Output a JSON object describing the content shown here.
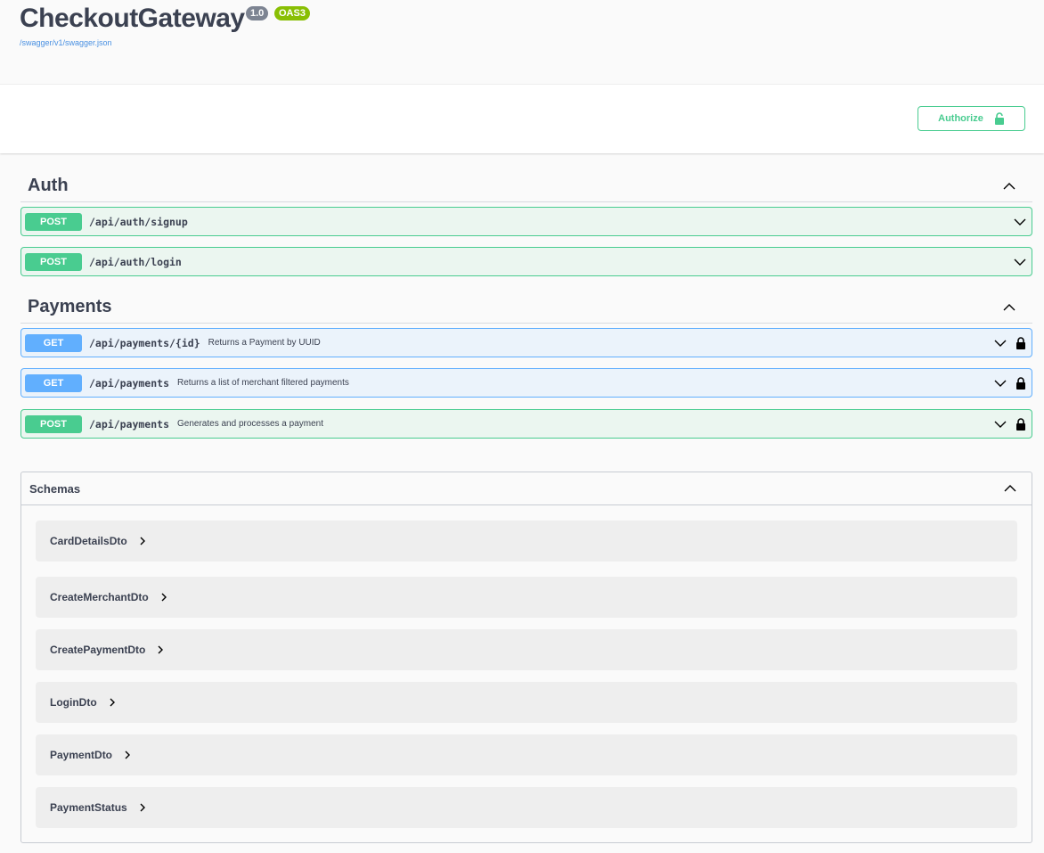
{
  "info": {
    "title": "CheckoutGateway",
    "version": "1.0",
    "oas": "OAS3",
    "spec_url": "/swagger/v1/swagger.json"
  },
  "authorize": {
    "label": "Authorize",
    "icon": "unlocked-lock-icon"
  },
  "tags": [
    {
      "name": "Auth",
      "operations": [
        {
          "method": "POST",
          "path": "/api/auth/signup",
          "summary": "",
          "locked": false
        },
        {
          "method": "POST",
          "path": "/api/auth/login",
          "summary": "",
          "locked": false
        }
      ]
    },
    {
      "name": "Payments",
      "operations": [
        {
          "method": "GET",
          "path": "/api/payments/{id}",
          "summary": "Returns a Payment by UUID",
          "locked": true
        },
        {
          "method": "GET",
          "path": "/api/payments",
          "summary": "Returns a list of merchant filtered payments",
          "locked": true
        },
        {
          "method": "POST",
          "path": "/api/payments",
          "summary": "Generates and processes a payment",
          "locked": true
        }
      ]
    }
  ],
  "schemas": {
    "title": "Schemas",
    "models": [
      "CardDetailsDto",
      "CreateMerchantDto",
      "CreatePaymentDto",
      "LoginDto",
      "PaymentDto",
      "PaymentStatus"
    ]
  },
  "colors": {
    "post": "#49cc90",
    "get": "#61affe",
    "accent": "#89bf04",
    "text": "#3b4151"
  }
}
